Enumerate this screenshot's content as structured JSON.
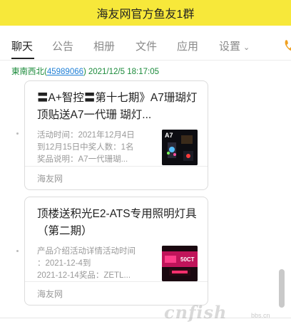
{
  "window": {
    "title": "海友网官方鱼友1群"
  },
  "tabs": [
    {
      "label": "聊天",
      "active": true
    },
    {
      "label": "公告",
      "active": false
    },
    {
      "label": "相册",
      "active": false
    },
    {
      "label": "文件",
      "active": false
    },
    {
      "label": "应用",
      "active": false
    },
    {
      "label": "设置",
      "active": false
    }
  ],
  "message": {
    "sender": "東南西北",
    "sender_id": "45989066",
    "open_paren": "(",
    "close_paren": ")",
    "timestamp": "2021/12/5 18:17:05"
  },
  "cards": [
    {
      "title": "〓A+智控〓第十七期》A7珊瑚灯顶贴送A7一代珊 瑚灯...",
      "desc_lines": [
        "活动时间：2021年12月4日",
        "到12月15日中奖人数：1名",
        "奖品说明：A7一代珊瑚..."
      ],
      "thumb_text": "A7",
      "source": "海友网"
    },
    {
      "title": "顶楼送积光E2-ATS专用照明灯具（第二期）",
      "desc_lines": [
        "产品介绍活动详情活动时间",
        "：2021-12-4到",
        "2021-12-14奖品：ZETL..."
      ],
      "thumb_text": "50CT",
      "source": "海友网"
    }
  ],
  "watermark": {
    "main": "cnfish",
    "sub": "bbs.cn"
  },
  "colors": {
    "title_bar": "#f7e83a",
    "sender_name": "#1a8a3a",
    "sender_link": "#1e7fd6",
    "phone_icon": "#f0a020"
  }
}
